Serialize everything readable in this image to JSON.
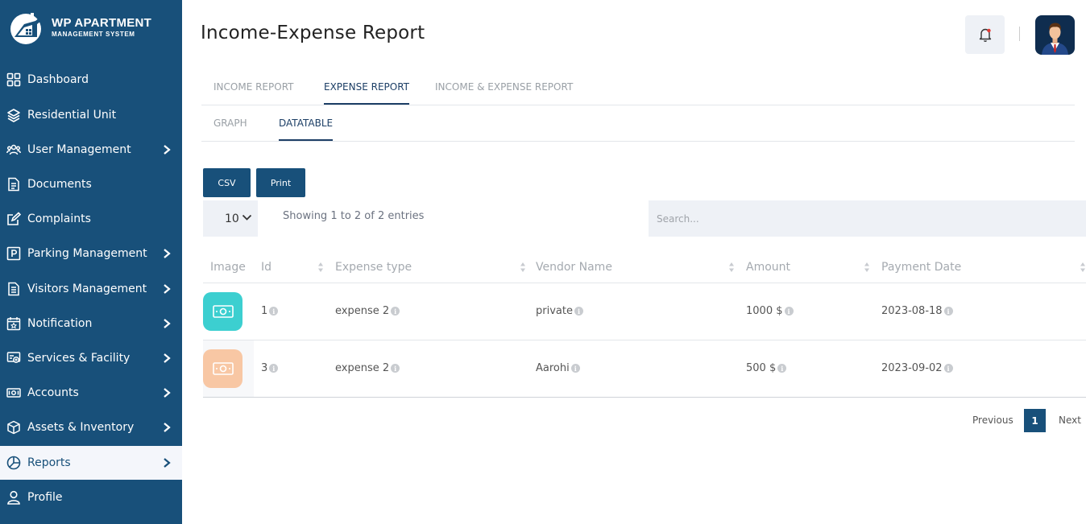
{
  "brand": {
    "title": "WP APARTMENT",
    "subtitle": "MANAGEMENT SYSTEM"
  },
  "sidebar": {
    "items": [
      {
        "label": "Dashboard",
        "icon": "grid-icon"
      },
      {
        "label": "Residential Unit",
        "icon": "layers-icon"
      },
      {
        "label": "User Management",
        "icon": "users-icon"
      },
      {
        "label": "Documents",
        "icon": "document-icon"
      },
      {
        "label": "Complaints",
        "icon": "edit-icon"
      },
      {
        "label": "Parking Management",
        "icon": "parking-icon"
      },
      {
        "label": "Visitors Management",
        "icon": "list-icon"
      },
      {
        "label": "Notification",
        "icon": "calendar-star-icon"
      },
      {
        "label": "Services & Facility",
        "icon": "service-icon"
      },
      {
        "label": "Accounts",
        "icon": "money-icon"
      },
      {
        "label": "Assets & Inventory",
        "icon": "box-icon"
      },
      {
        "label": "Reports",
        "icon": "pie-chart-icon"
      },
      {
        "label": "Profile",
        "icon": "person-icon"
      }
    ]
  },
  "header": {
    "title": "Income-Expense Report"
  },
  "tabs": {
    "primary": [
      "INCOME REPORT",
      "EXPENSE REPORT",
      "INCOME & EXPENSE REPORT"
    ],
    "secondary": [
      "GRAPH",
      "DATATABLE"
    ]
  },
  "toolbar": {
    "csv": "CSV",
    "print": "Print"
  },
  "table_controls": {
    "length": "10",
    "info": "Showing 1 to 2 of 2 entries",
    "search_placeholder": "Search..."
  },
  "table": {
    "columns": [
      "Image",
      "Id",
      "Expense type",
      "Vendor Name",
      "Amount",
      "Payment Date"
    ],
    "rows": [
      {
        "id": "1",
        "expense_type": "expense 2",
        "vendor": "private",
        "amount": "1000 $",
        "date": "2023-08-18",
        "tile_color": "#3ccfd0"
      },
      {
        "id": "3",
        "expense_type": "expense 2",
        "vendor": "Aarohi",
        "amount": "500 $",
        "date": "2023-09-02",
        "tile_color": "#f8c7a4"
      }
    ]
  },
  "pagination": {
    "previous": "Previous",
    "page": "1",
    "next": "Next"
  },
  "colors": {
    "sidebar": "#18507a",
    "accent": "#1d3f66"
  }
}
